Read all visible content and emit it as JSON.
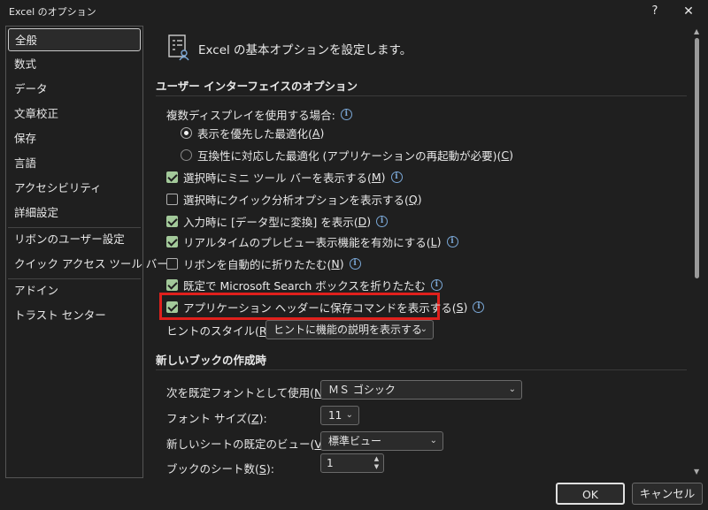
{
  "window": {
    "title": "Excel のオプション",
    "help_label": "?",
    "close_label": "✕"
  },
  "sidebar": {
    "items": [
      {
        "label": "全般",
        "selected": true
      },
      {
        "label": "数式"
      },
      {
        "label": "データ"
      },
      {
        "label": "文章校正"
      },
      {
        "label": "保存"
      },
      {
        "label": "言語"
      },
      {
        "label": "アクセシビリティ"
      },
      {
        "label": "詳細設定"
      },
      {
        "label": "リボンのユーザー設定"
      },
      {
        "label": "クイック アクセス ツール バー"
      },
      {
        "label": "アドイン"
      },
      {
        "label": "トラスト センター"
      }
    ]
  },
  "header": {
    "icon": "settings-list-icon",
    "title": "Excel の基本オプションを設定します。"
  },
  "ui_section": {
    "title": "ユーザー インターフェイスのオプション",
    "multi_display_label": "複数ディスプレイを使用する場合:",
    "radio_appearance": {
      "text": "表示を優先した最適化(",
      "key": "A",
      "end": ")",
      "selected": true
    },
    "radio_compat": {
      "text": "互換性に対応した最適化 (アプリケーションの再起動が必要)(",
      "key": "C",
      "end": ")",
      "selected": false
    },
    "checkboxes": [
      {
        "text": "選択時にミニ ツール バーを表示する(",
        "key": "M",
        "end": ")",
        "checked": true,
        "info": true
      },
      {
        "text": "選択時にクイック分析オプションを表示する(",
        "key": "Q",
        "end": ")",
        "checked": false,
        "info": false
      },
      {
        "text": "入力時に [データ型に変換] を表示(",
        "key": "D",
        "end": ")",
        "checked": true,
        "info": true
      },
      {
        "text": "リアルタイムのプレビュー表示機能を有効にする(",
        "key": "L",
        "end": ")",
        "checked": true,
        "info": true
      },
      {
        "text": "リボンを自動的に折りたたむ(",
        "key": "N",
        "end": ")",
        "checked": false,
        "info": true
      },
      {
        "text": "既定で Microsoft Search ボックスを折りたたむ",
        "key": "",
        "end": "",
        "checked": true,
        "info": true
      },
      {
        "text": "アプリケーション ヘッダーに保存コマンドを表示する(",
        "key": "S",
        "end": ")",
        "checked": true,
        "info": true
      }
    ],
    "tooltip_style_label": {
      "text": "ヒントのスタイル(",
      "key": "R",
      "end": "):"
    },
    "tooltip_style_value": "ヒントに機能の説明を表示する"
  },
  "new_book_section": {
    "title": "新しいブックの作成時",
    "default_font_label": {
      "text": "次を既定フォントとして使用(",
      "key": "N",
      "end": "):"
    },
    "default_font_value": "ＭＳ ゴシック",
    "font_size_label": {
      "text": "フォント サイズ(",
      "key": "Z",
      "end": "):"
    },
    "font_size_value": "11",
    "default_view_label": {
      "text": "新しいシートの既定のビュー(",
      "key": "V",
      "end": "):"
    },
    "default_view_value": "標準ビュー",
    "sheet_count_label": {
      "text": "ブックのシート数(",
      "key": "S",
      "end": "):"
    },
    "sheet_count_value": "1"
  },
  "buttons": {
    "ok": "OK",
    "cancel": "キャンセル"
  },
  "colors": {
    "background": "#1f1f1f",
    "checkbox_on": "#a3c99a",
    "highlight": "#e0201c",
    "info": "#7aa7d6"
  }
}
